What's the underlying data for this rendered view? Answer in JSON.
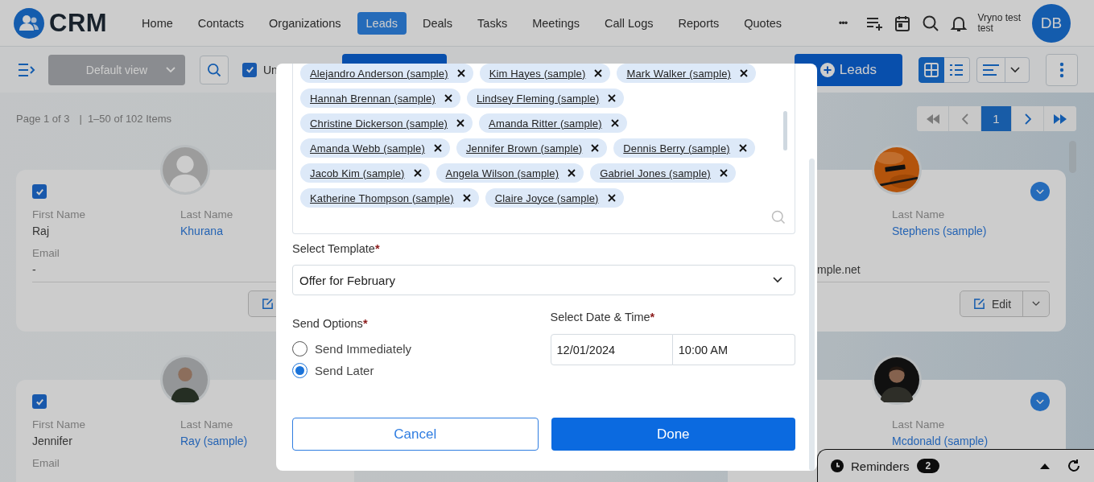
{
  "nav": {
    "logo": "CRM",
    "items": [
      {
        "label": "Home",
        "selected": false
      },
      {
        "label": "Contacts",
        "selected": false
      },
      {
        "label": "Organizations",
        "selected": false
      },
      {
        "label": "Leads",
        "selected": true
      },
      {
        "label": "Deals",
        "selected": false
      },
      {
        "label": "Tasks",
        "selected": false
      },
      {
        "label": "Meetings",
        "selected": false
      },
      {
        "label": "Call Logs",
        "selected": false
      },
      {
        "label": "Reports",
        "selected": false
      },
      {
        "label": "Quotes",
        "selected": false
      }
    ],
    "more": "•••",
    "user_name": "Vryno test",
    "user_sub": "test",
    "initials": "DB"
  },
  "toolbar": {
    "view": "Default view",
    "filter": {
      "label": "Un",
      "checked": true
    },
    "add_label": "Leads",
    "views": [
      {
        "kind": "grid",
        "selected": true
      },
      {
        "kind": "list",
        "selected": false
      }
    ]
  },
  "summary": {
    "page": "Page 1 of 3",
    "separator": "|",
    "range": "1–50 of 102 Items"
  },
  "pagination": {
    "current": "1"
  },
  "card_rows": [
    {
      "left": {
        "checked": true,
        "avatar": {
          "kind": "placeholder"
        },
        "fields": [
          {
            "kind": "first_name",
            "label": "First Name",
            "value": "Raj"
          },
          {
            "kind": "last_name",
            "label": "Last Name",
            "value": "Khurana"
          },
          {
            "kind": "email",
            "label": "Email",
            "value": "-"
          }
        ],
        "edit_button": true
      },
      "right": {
        "menu": true,
        "fields": [
          {
            "kind": "last_name",
            "label": "Last Name",
            "value": "Stephens (sample)"
          },
          {
            "kind": "email",
            "value": "mple.net"
          }
        ],
        "edit_button": true,
        "edit_label": "Edit"
      }
    },
    {
      "left": {
        "checked": true,
        "avatar": {
          "kind": "portrait-light"
        },
        "fields": [
          {
            "kind": "first_name",
            "label": "First Name",
            "value": "Jennifer"
          },
          {
            "kind": "last_name",
            "label": "Last Name",
            "value": "Ray (sample)"
          },
          {
            "kind": "email",
            "label": "Email"
          }
        ]
      },
      "right": {
        "avatar": {
          "kind": "portrait-dark"
        },
        "menu": true,
        "fields": [
          {
            "kind": "last_name",
            "label": "Last Name",
            "value": "Mcdonald (sample)"
          }
        ]
      }
    }
  ],
  "modal": {
    "recipients": [
      "Alejandro Anderson (sample)",
      "Kim Hayes (sample)",
      "Mark Walker (sample)",
      "Hannah Brennan (sample)",
      "Lindsey Fleming (sample)",
      "Christine Dickerson (sample)",
      "Amanda Ritter (sample)",
      "Amanda Webb (sample)",
      "Jennifer Brown (sample)",
      "Dennis Berry (sample)",
      "Jacob Kim (sample)",
      "Angela Wilson (sample)",
      "Gabriel Jones (sample)",
      "Katherine Thompson (sample)",
      "Claire Joyce (sample)"
    ],
    "required_mark": "*",
    "template_label": "Select Template",
    "template_value": "Offer for February",
    "send_label": "Send Options",
    "options": [
      {
        "label": "Send Immediately",
        "selected": false
      },
      {
        "label": "Send Later",
        "selected": true
      }
    ],
    "date_label": "Select Date & Time",
    "date": "12/01/2024",
    "time": "10:00 AM",
    "cancel": "Cancel",
    "done": "Done"
  },
  "reminders": {
    "label": "Reminders",
    "count": "2"
  }
}
